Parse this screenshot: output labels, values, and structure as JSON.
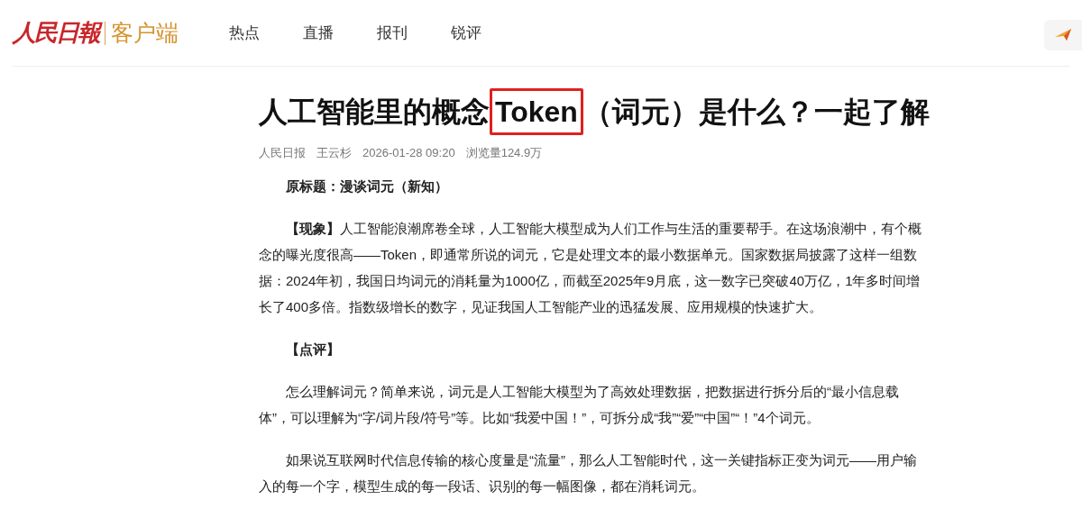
{
  "header": {
    "logo": {
      "brand": "人民日報",
      "suffix": "客户端"
    },
    "nav": [
      {
        "label": "热点"
      },
      {
        "label": "直播"
      },
      {
        "label": "报刊"
      },
      {
        "label": "锐评"
      }
    ]
  },
  "article": {
    "title_parts": [
      {
        "text": "人工智能里的概念",
        "highlighted": false
      },
      {
        "text": "Token",
        "highlighted": true
      },
      {
        "text": "（词元）是什么？一起了解",
        "highlighted": false
      }
    ],
    "meta": [
      "人民日报",
      "王云杉",
      "2026-01-28 09:20",
      "浏览量124.9万"
    ],
    "paragraphs": [
      {
        "kind": "heading",
        "text": "原标题：漫谈词元（新知）"
      },
      {
        "kind": "body",
        "text": "**【现象】**人工智能浪潮席卷全球，人工智能大模型成为人们工作与生活的重要帮手。在这场浪潮中，有个概念的曝光度很高——Token，即通常所说的词元，它是处理文本的最小数据单元。国家数据局披露了这样一组数据：2024年初，我国日均词元的消耗量为1000亿，而截至2025年9月底，这一数字已突破40万亿，1年多时间增长了400多倍。指数级增长的数字，见证我国人工智能产业的迅猛发展、应用规模的快速扩大。"
      },
      {
        "kind": "heading",
        "text": "【点评】"
      },
      {
        "kind": "body",
        "text": "怎么理解词元？简单来说，词元是人工智能大模型为了高效处理数据，把数据进行拆分后的“最小信息载体”，可以理解为“字/词片段/符号”等。比如“我爱中国！”，可拆分成“我”“爱”“中国”“！”4个词元。"
      },
      {
        "kind": "body",
        "text": "如果说互联网时代信息传输的核心度量是“流量”，那么人工智能时代，这一关键指标正变为词元——用户输入的每一个字，模型生成的每一段话、识别的每一幅图像，都在消耗词元。"
      }
    ]
  }
}
